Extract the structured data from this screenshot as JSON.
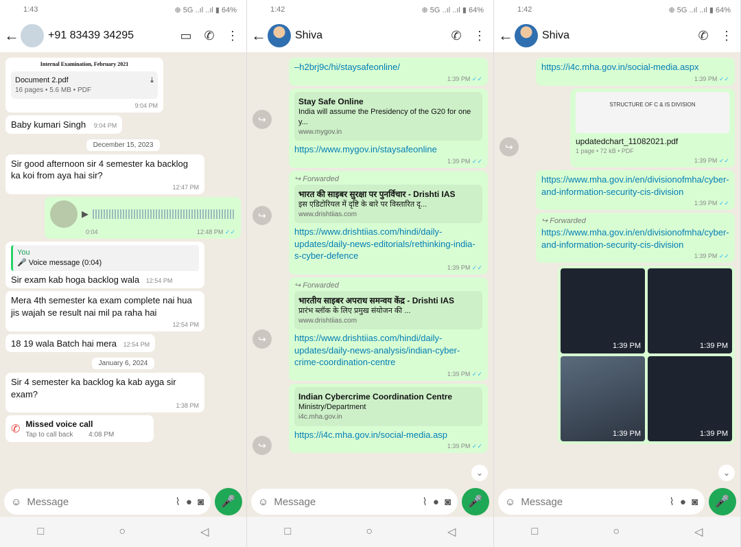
{
  "panels": [
    {
      "status_time": "1:43",
      "status_icons": "⊕ 5G ..ıl ..ıl ▮ 64%",
      "contact": "+91 83439 34295",
      "icons": [
        "video-icon",
        "phone-icon",
        "more-icon"
      ],
      "messages": {
        "doc_header": "Internal Examination, February 2021",
        "doc_name": "Document 2.pdf",
        "doc_meta": "16 pages • 5.6 MB • PDF",
        "doc_time": "9:04 PM",
        "name_msg": "Baby kumari Singh",
        "name_time": "9:04 PM",
        "date1": "December 15, 2023",
        "msg1": "Sir good afternoon sir 4 semester ka backlog ka koi from aya hai sir?",
        "msg1_time": "12:47 PM",
        "voice_dur": "0:04",
        "voice_time": "12:48 PM",
        "quote_you": "You",
        "quote_text": "Voice message (0:04)",
        "msg2": "Sir exam kab hoga backlog wala",
        "msg2_time": "12:54 PM",
        "msg3": "Mera 4th semester ka exam complete nai hua jis wajah se result nai mil pa raha hai",
        "msg3_time": "12:54 PM",
        "msg4": "18 19 wala Batch hai mera",
        "msg4_time": "12:54 PM",
        "date2": "January 6, 2024",
        "msg5": "Sir 4 semester ka backlog ka kab ayga sir exam?",
        "msg5_time": "1:38 PM",
        "missed_title": "Missed voice call",
        "missed_sub": "Tap to call back",
        "missed_time": "4:08 PM"
      }
    },
    {
      "status_time": "1:42",
      "status_icons": "⊕ 5G ..ıl ..ıl ▮ 64%",
      "contact": "Shiva",
      "messages": {
        "link0": "–h2brj9c/hi/staysafeonline/",
        "link0_time": "1:39 PM",
        "card1_title": "Stay Safe Online",
        "card1_desc": "India will assume the Presidency of the G20 for one y...",
        "card1_url": "www.mygov.in",
        "link1": "https://www.mygov.in/staysafeonline",
        "link1_time": "1:39 PM",
        "fwd": "Forwarded",
        "card2_title": "भारत की साइबर सुरक्षा पर पुनर्विचार - Drishti IAS",
        "card2_desc": "इस एडिटोरियल में दृष्टि के बारे पर विस्तारित दृ...",
        "card2_url": "www.drishtiias.com",
        "link2": "https://www.drishtiias.com/hindi/daily-updates/daily-news-editorials/rethinking-india-s-cyber-defence",
        "link2_time": "1:39 PM",
        "card3_title": "भारतीय साइबर अपराध समन्वय केंद्र - Drishti IAS",
        "card3_desc": "प्रारंभ ब्लॉक के लिए प्रमुख संयोजन की ...",
        "card3_url": "www.drishtiias.com",
        "link3": "https://www.drishtiias.com/hindi/daily-updates/daily-news-analysis/indian-cyber-crime-coordination-centre",
        "link3_time": "1:39 PM",
        "card4_title": "Indian Cybercrime Coordination Centre",
        "card4_desc": "Ministry/Department",
        "card4_url": "i4c.mha.gov.in",
        "link4": "https://i4c.mha.gov.in/social-media.asp",
        "link4_time": "1:39 PM"
      }
    },
    {
      "status_time": "1:42",
      "status_icons": "⊕ 5G ..ıl ..ıl ▮ 64%",
      "contact": "Shiva",
      "messages": {
        "link0": "https://i4c.mha.gov.in/social-media.aspx",
        "link0_time": "1:39 PM",
        "pdf_thumb": "STRUCTURE OF C & IS DIVISION",
        "pdf_name": "updatedchart_11082021.pdf",
        "pdf_meta": "1 page • 72 kB • PDF",
        "pdf_time": "1:39 PM",
        "link1": "https://www.mha.gov.in/en/divisionofmha/cyber-and-information-security-cis-division",
        "link1_time": "1:39 PM",
        "fwd": "Forwarded",
        "link2": "https://www.mha.gov.in/en/divisionofmha/cyber-and-information-security-cis-division",
        "link2_time": "1:39 PM",
        "img_times": [
          "1:39 PM",
          "1:39 PM",
          "1:39 PM",
          "1:39 PM"
        ]
      }
    }
  ],
  "composer": {
    "placeholder": "Message"
  }
}
